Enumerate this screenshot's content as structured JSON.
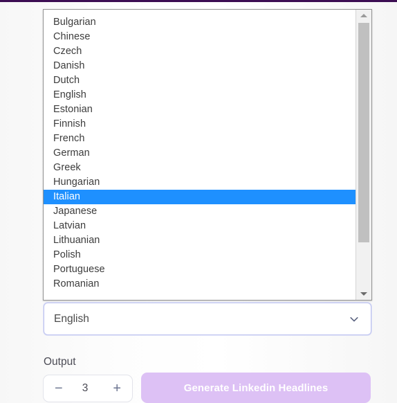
{
  "theme": {
    "top_bar_color": "#3c0d53",
    "selection_color": "#1e90ff",
    "button_color": "#ddc1f5",
    "focus_border_color": "#bfc4f0"
  },
  "language_listbox": {
    "name": "language-options-popup",
    "selected": "Italian",
    "options": [
      "Bulgarian",
      "Chinese",
      "Czech",
      "Danish",
      "Dutch",
      "English",
      "Estonian",
      "Finnish",
      "French",
      "German",
      "Greek",
      "Hungarian",
      "Italian",
      "Japanese",
      "Latvian",
      "Lithuanian",
      "Polish",
      "Portuguese",
      "Romanian"
    ],
    "scrollbar": {
      "up_arrow_icon": "triangle-up-icon",
      "down_arrow_icon": "triangle-down-icon"
    }
  },
  "language_select": {
    "value": "English",
    "chevron_icon": "chevron-down-icon"
  },
  "output_section": {
    "label": "Output",
    "stepper": {
      "decrement_label": "−",
      "value": "3",
      "increment_label": "+"
    }
  },
  "generate_button": {
    "label": "Generate Linkedin Headlines"
  }
}
